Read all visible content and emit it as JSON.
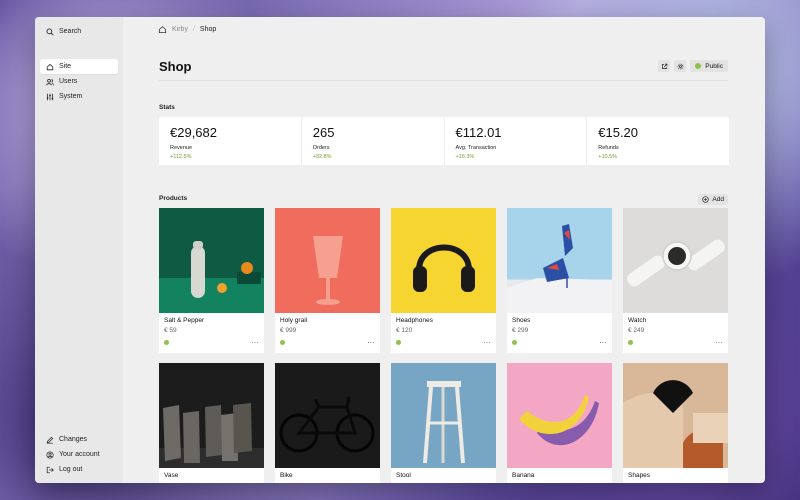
{
  "sidebar": {
    "search_label": "Search",
    "items": [
      {
        "label": "Site",
        "icon": "home-icon",
        "active": true
      },
      {
        "label": "Users",
        "icon": "users-icon",
        "active": false
      },
      {
        "label": "System",
        "icon": "sliders-icon",
        "active": false
      }
    ],
    "bottom_items": [
      {
        "label": "Changes",
        "icon": "edit-icon"
      },
      {
        "label": "Your account",
        "icon": "account-icon"
      },
      {
        "label": "Log out",
        "icon": "logout-icon"
      }
    ]
  },
  "breadcrumb": {
    "root": "Kirby",
    "separator": "/",
    "current": "Shop"
  },
  "header": {
    "title": "Shop",
    "status_label": "Public",
    "status_color": "#8bc34a"
  },
  "stats_section": {
    "label": "Stats",
    "items": [
      {
        "value": "€29,682",
        "label": "Revenue",
        "trend": "+112.5%"
      },
      {
        "value": "265",
        "label": "Orders",
        "trend": "+82.8%"
      },
      {
        "value": "€112.01",
        "label": "Avg. Transaction",
        "trend": "+16.3%"
      },
      {
        "value": "€15.20",
        "label": "Refunds",
        "trend": "+10.5%"
      }
    ]
  },
  "products_section": {
    "label": "Products",
    "add_label": "Add",
    "items": [
      {
        "title": "Salt & Pepper",
        "price": "€ 59"
      },
      {
        "title": "Holy grail",
        "price": "€ 999"
      },
      {
        "title": "Headphones",
        "price": "€ 120"
      },
      {
        "title": "Shoes",
        "price": "€ 299"
      },
      {
        "title": "Watch",
        "price": "€ 249"
      },
      {
        "title": "Vase",
        "price": ""
      },
      {
        "title": "Bike",
        "price": ""
      },
      {
        "title": "Stool",
        "price": ""
      },
      {
        "title": "Banana",
        "price": ""
      },
      {
        "title": "Shapes",
        "price": ""
      }
    ]
  },
  "colors": {
    "accent_green": "#8bc34a",
    "trend_green": "#6aa32c"
  }
}
